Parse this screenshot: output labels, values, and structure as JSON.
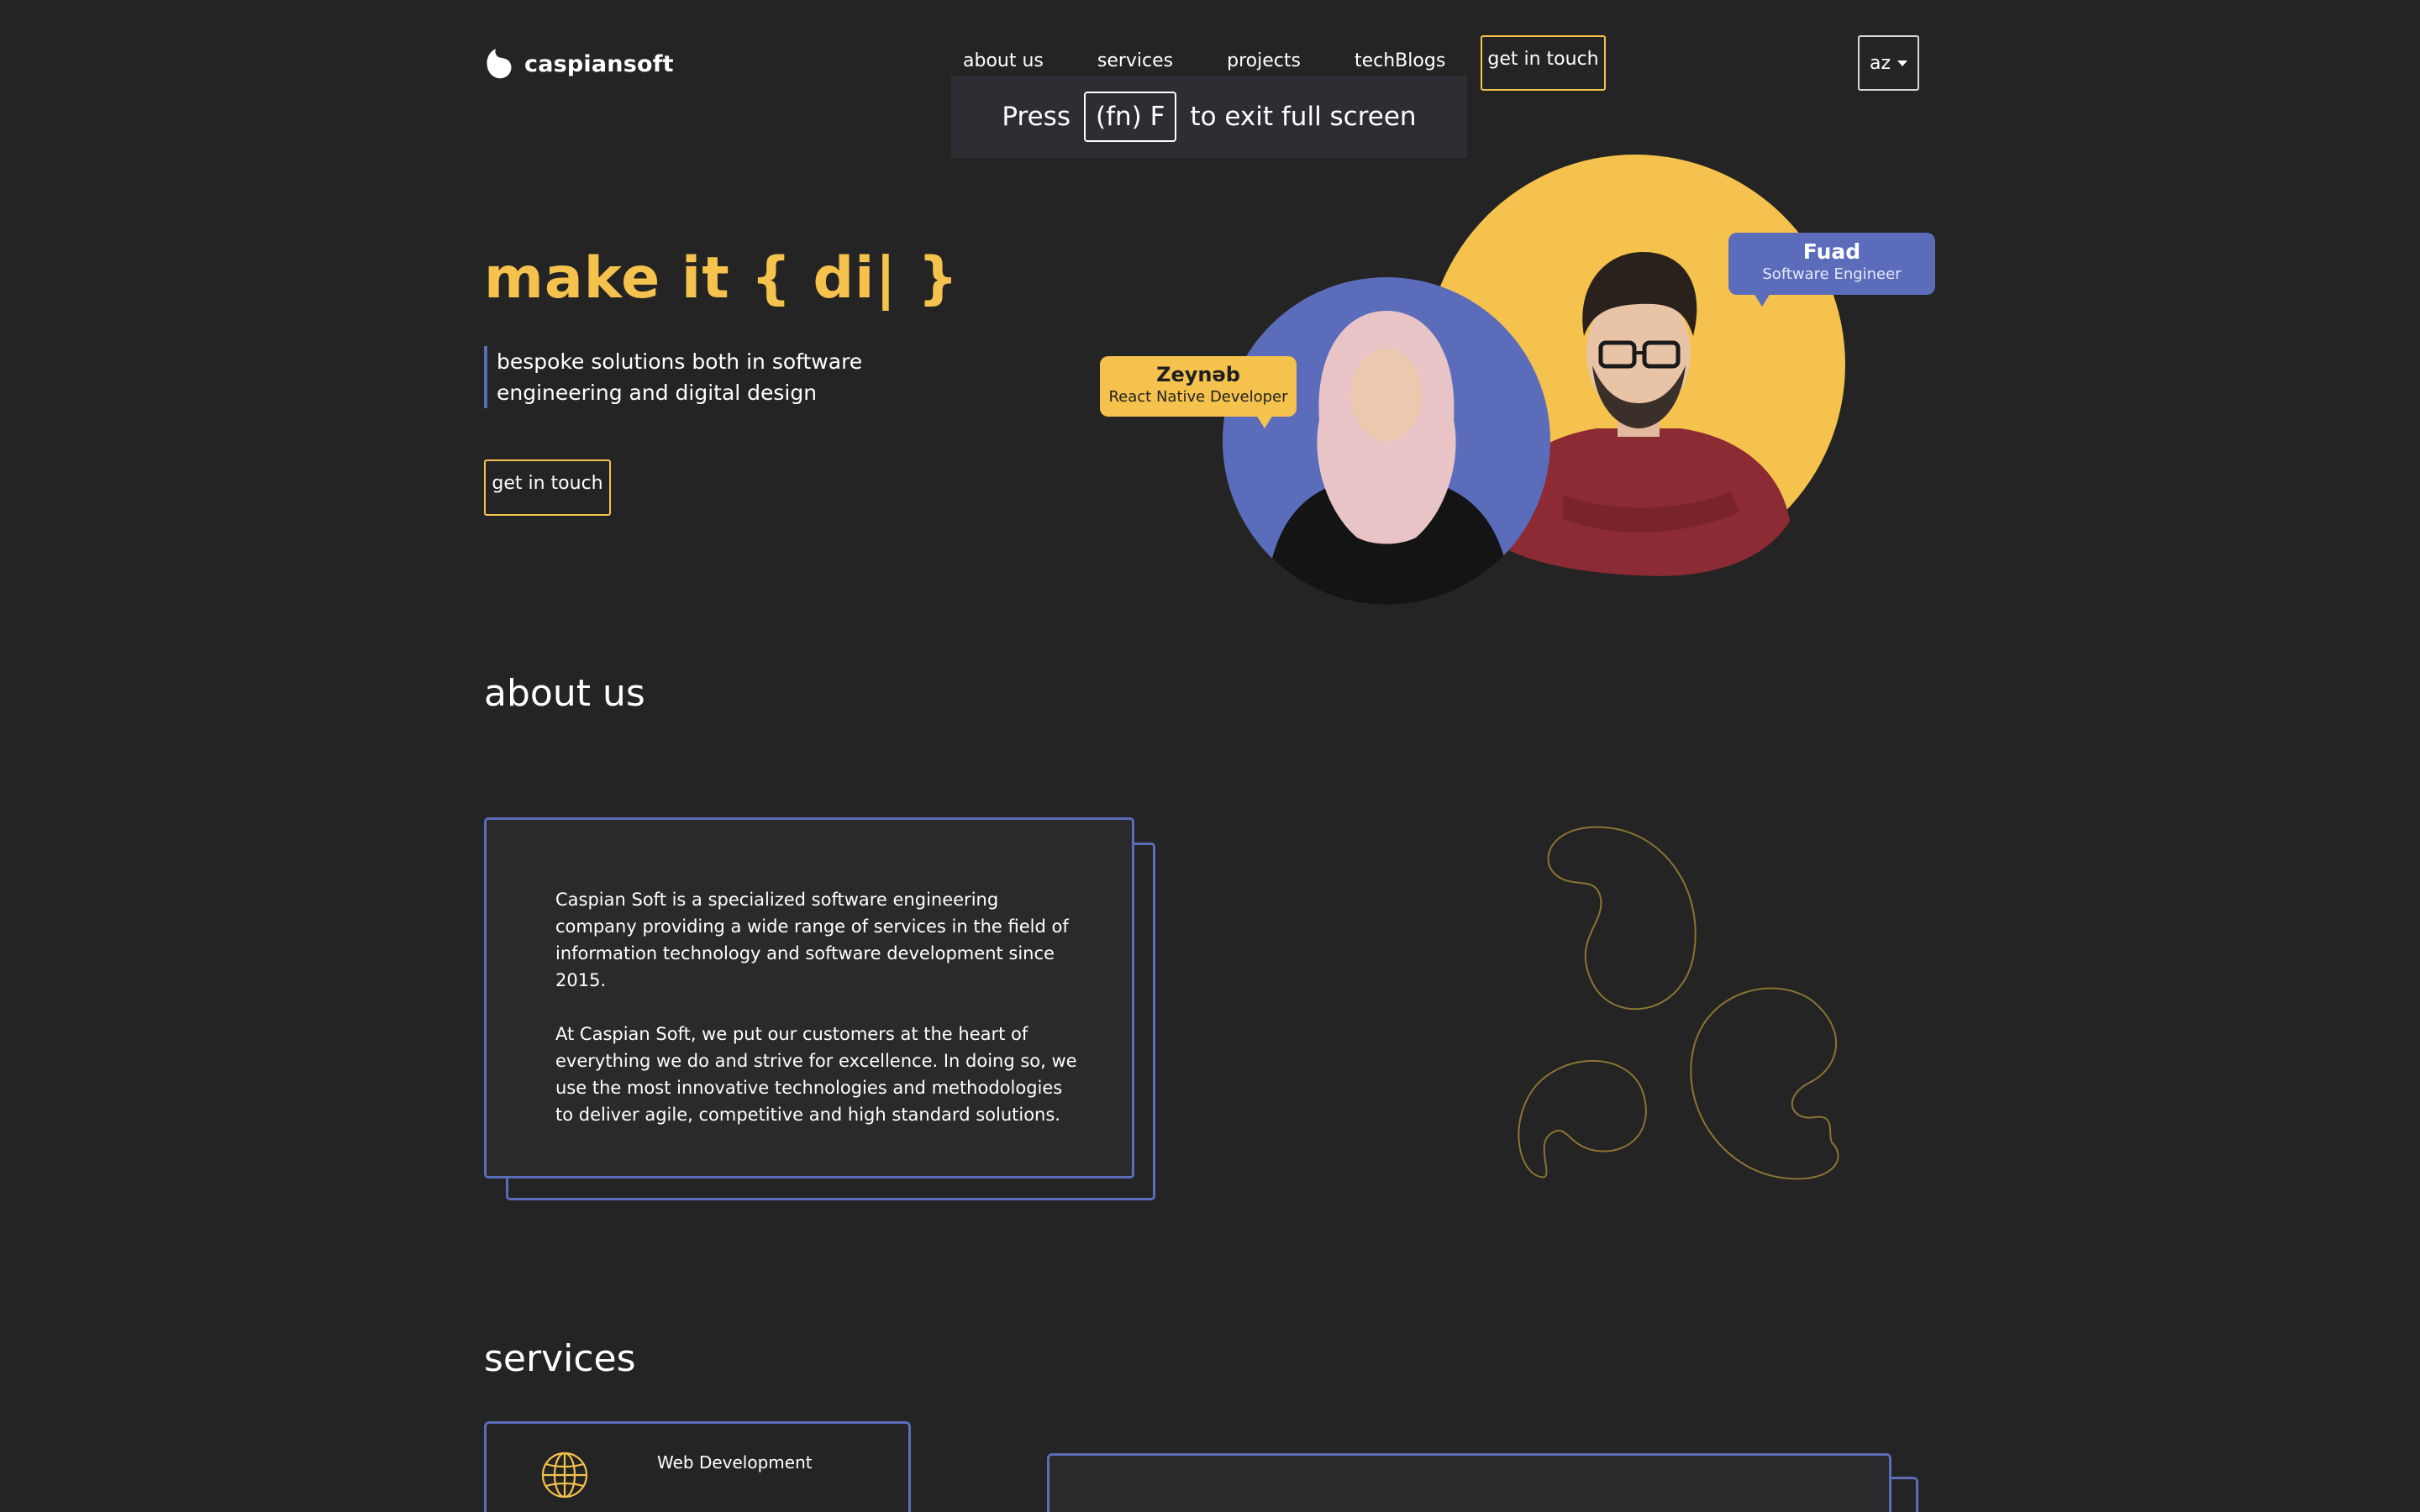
{
  "brand": {
    "name": "caspiansoft"
  },
  "nav": {
    "items": [
      {
        "label": "about us"
      },
      {
        "label": "services"
      },
      {
        "label": "projects"
      },
      {
        "label": "techBlogs"
      }
    ],
    "cta_label": "get in touch",
    "language": "az"
  },
  "fullscreen_notice": {
    "press": "Press",
    "key": "(fn) F",
    "rest": "to exit full screen"
  },
  "hero": {
    "title": "make it { di| }",
    "subtitle": "bespoke solutions both in software engineering and digital design",
    "cta_label": "get in touch",
    "people": [
      {
        "name": "Zeynəb",
        "role": "React Native Developer"
      },
      {
        "name": "Fuad",
        "role": "Software Engineer"
      }
    ]
  },
  "about": {
    "title": "about us",
    "paragraphs": [
      "Caspian Soft is a specialized software engineering company providing a wide range of services in the field of information technology and software development since 2015.",
      "At Caspian Soft, we put our customers at the heart of everything we do and strive for excellence. In doing so, we use the most innovative technologies and methodologies to deliver agile, competitive and high standard solutions."
    ]
  },
  "services": {
    "title": "services",
    "items": [
      {
        "label": "Web Development",
        "icon": "globe-icon"
      }
    ]
  },
  "colors": {
    "background": "#242424",
    "accent_yellow": "#f4c24d",
    "accent_blue": "#5b6dba"
  }
}
